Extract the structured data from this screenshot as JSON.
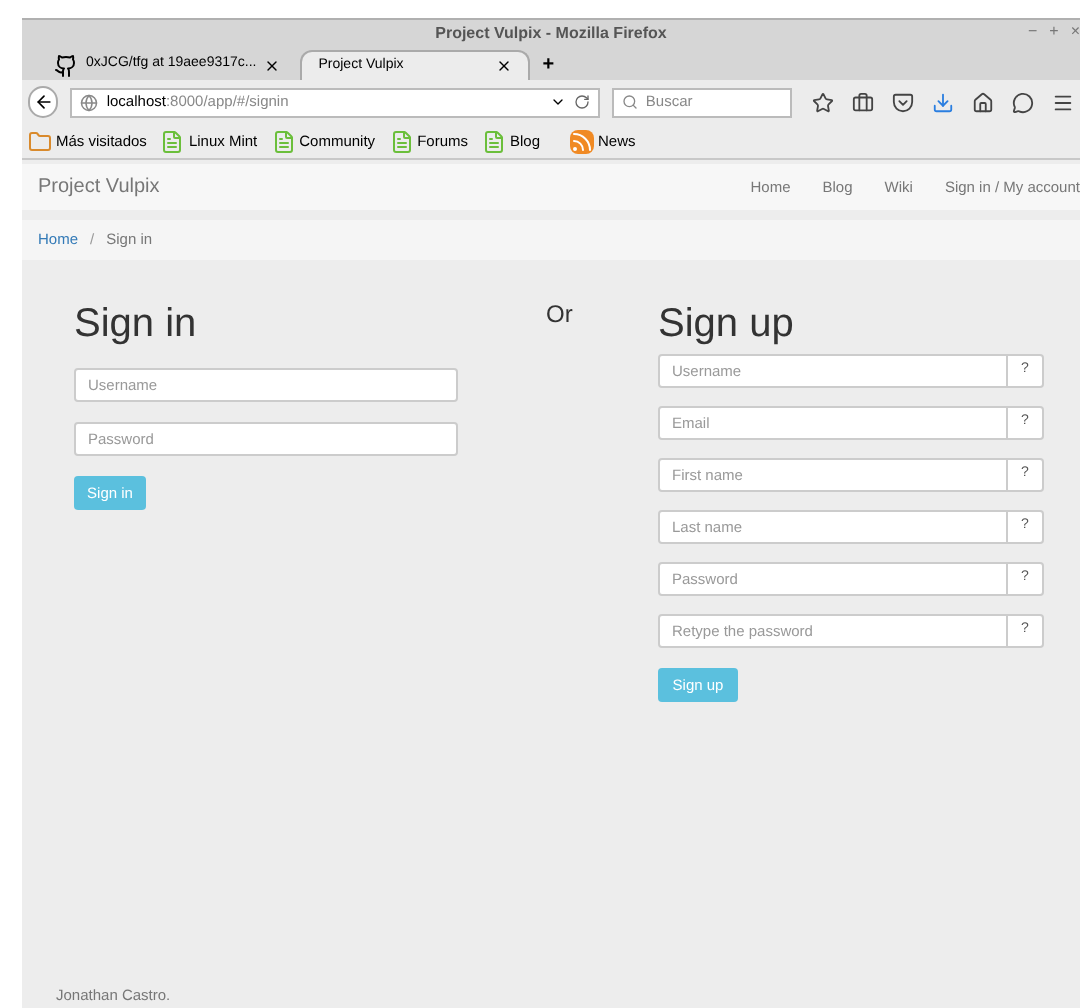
{
  "window": {
    "title": "Project Vulpix - Mozilla Firefox",
    "controls": [
      "−",
      "+",
      "×"
    ]
  },
  "tabs": [
    {
      "label": "0xJCG/tfg at 19aee9317c...",
      "selected": false,
      "kind": "github"
    },
    {
      "label": "Project Vulpix",
      "selected": true,
      "kind": "page"
    }
  ],
  "new_tab": "+",
  "address_bar": {
    "host": "localhost",
    "path": ":8000/app/#/signin"
  },
  "search": {
    "placeholder": "Buscar"
  },
  "bookmarks": [
    {
      "label": "Más visitados",
      "kind": "folder"
    },
    {
      "label": "Linux Mint",
      "kind": "mint"
    },
    {
      "label": "Community",
      "kind": "mint"
    },
    {
      "label": "Forums",
      "kind": "mint"
    },
    {
      "label": "Blog",
      "kind": "mint"
    },
    {
      "label": "News",
      "kind": "rss"
    }
  ],
  "navbar": {
    "brand": "Project Vulpix",
    "links": [
      "Home",
      "Blog",
      "Wiki",
      "Sign in / My account"
    ]
  },
  "breadcrumb_divider": "/",
  "breadcrumb": [
    {
      "label": "Home",
      "kind": "link"
    },
    {
      "label": "Sign in",
      "kind": "current"
    }
  ],
  "separator": "Or",
  "sign_in": {
    "title": "Sign in",
    "fields": [
      {
        "placeholder": "Username"
      },
      {
        "placeholder": "Password"
      }
    ],
    "button": "Sign in"
  },
  "sign_up": {
    "title": "Sign up",
    "fields": [
      {
        "placeholder": "Username",
        "help": "?"
      },
      {
        "placeholder": "Email",
        "help": "?"
      },
      {
        "placeholder": "First name",
        "help": "?"
      },
      {
        "placeholder": "Last name",
        "help": "?"
      },
      {
        "placeholder": "Password",
        "help": "?"
      },
      {
        "placeholder": "Retype the password",
        "help": "?"
      }
    ],
    "button": "Sign up"
  },
  "footer": "Jonathan Castro."
}
